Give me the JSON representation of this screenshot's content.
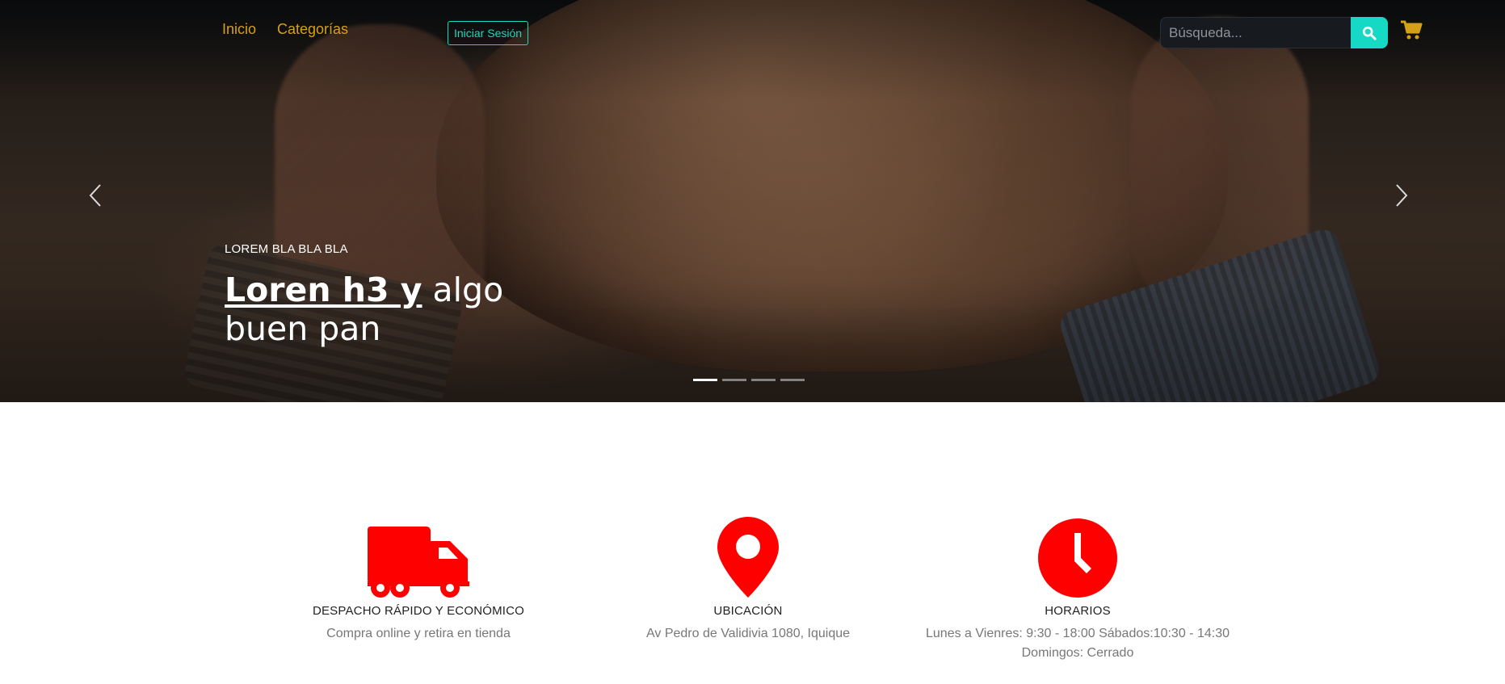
{
  "nav": {
    "inicio": "Inicio",
    "categorias": "Categorías",
    "login": "Iniciar Sesión",
    "search_placeholder": "Búsqueda..."
  },
  "hero": {
    "kicker": "LOREM BLA BLA BLA",
    "title_strong": "Loren h3 y",
    "title_rest": " algo",
    "title_line2": "buen pan",
    "active_slide": 1,
    "slide_count": 4
  },
  "features": [
    {
      "icon": "truck-icon",
      "title": "DESPACHO RÁPIDO Y ECONÓMICO",
      "text": "Compra online y retira en tienda"
    },
    {
      "icon": "map-pin-icon",
      "title": "UBICACIÓN",
      "text": "Av Pedro de Validivia 1080, Iquique"
    },
    {
      "icon": "clock-icon",
      "title": "HORARIOS",
      "text": "Lunes a Vienres: 9:30 - 18:00 Sábados:10:30 - 14:30 Domingos: Cerrado"
    }
  ],
  "colors": {
    "nav_link": "#d4a018",
    "accent": "#15d9c4",
    "feature_icon": "#ff0000"
  }
}
